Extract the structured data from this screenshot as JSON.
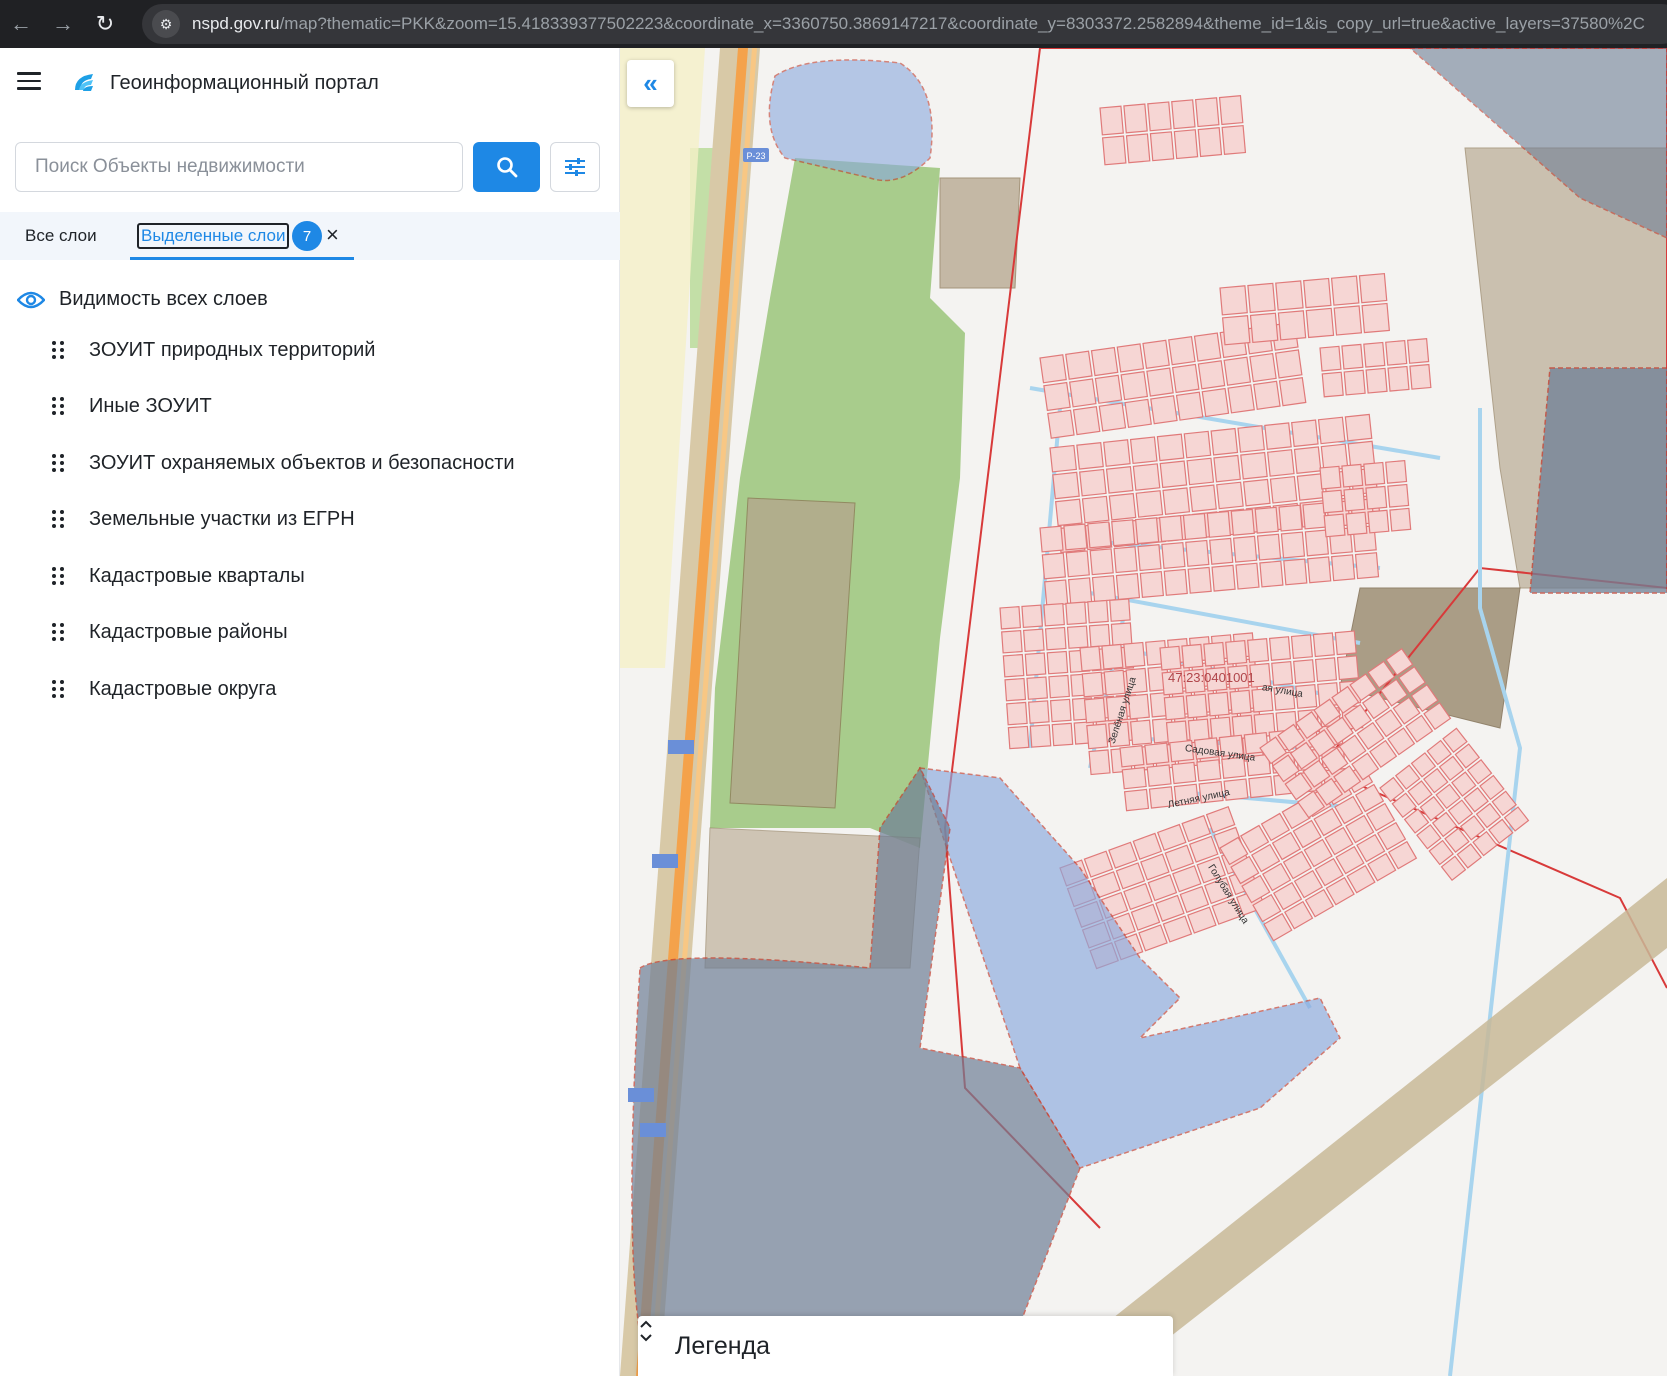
{
  "browser": {
    "url_host": "nspd.gov.ru",
    "url_path": "/map?thematic=PKK&zoom=15.418339377502223&coordinate_x=3360750.3869147217&coordinate_y=8303372.2582894&theme_id=1&is_copy_url=true&active_layers=37580%2C"
  },
  "app": {
    "title": "Геоинформационный портал"
  },
  "search": {
    "placeholder": "Поиск Объекты недвижимости"
  },
  "tabs": {
    "all_label": "Все слои",
    "selected_label": "Выделенные слои",
    "selected_count": "7"
  },
  "visibility": {
    "label": "Видимость всех слоев"
  },
  "layers": [
    {
      "label": "ЗОУИТ природных территорий"
    },
    {
      "label": "Иные ЗОУИТ"
    },
    {
      "label": "ЗОУИТ охраняемых объектов и безопасности"
    },
    {
      "label": "Земельные участки из ЕГРН"
    },
    {
      "label": "Кадастровые кварталы"
    },
    {
      "label": "Кадастровые районы"
    },
    {
      "label": "Кадастровые округа"
    }
  ],
  "map": {
    "quarter_label": "47:23:0401001",
    "road_label": "Р-23",
    "streets": [
      "Зелёная улица",
      "Садовая улица",
      "Летняя улица",
      "Голубая улица",
      "ая улица"
    ],
    "legend_title": "Легенда"
  },
  "colors": {
    "accent": "#1e88e5",
    "parcel_stroke": "#e07a7a",
    "parcel_fill": "#f6d6d4",
    "zone_blue": "#8aa9de",
    "zone_dark": "#6f7f96",
    "forest": "#a8cc8c",
    "ownership": "#b5a58c"
  }
}
